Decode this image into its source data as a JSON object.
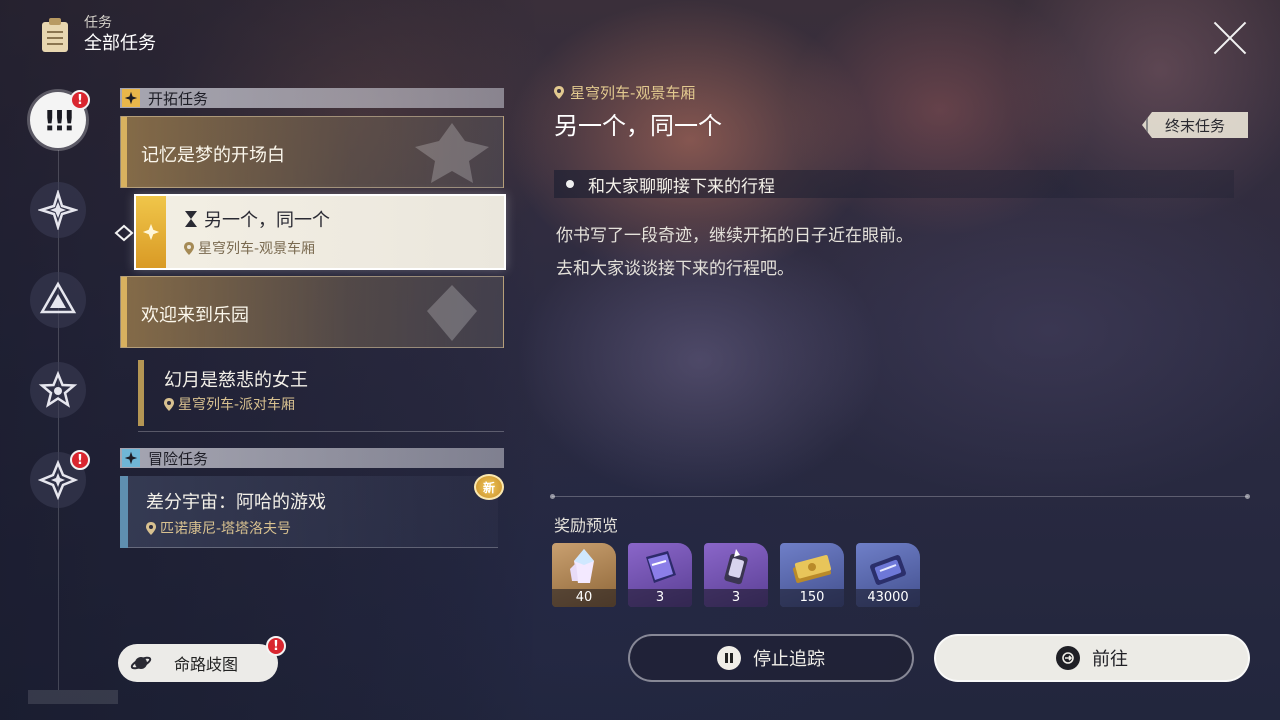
{
  "header": {
    "sub_title": "任务",
    "title": "全部任务"
  },
  "sections": {
    "trailblaze": "开拓任务",
    "adventure": "冒险任务"
  },
  "missions": [
    {
      "title": "记忆是梦的开场白"
    },
    {
      "title": "另一个，同一个",
      "location": "星穹列车-观景车厢"
    },
    {
      "title": "欢迎来到乐园"
    },
    {
      "title": "幻月是慈悲的女王",
      "location": "星穹列车-派对车厢"
    }
  ],
  "adventure_missions": [
    {
      "title": "差分宇宙：阿哈的游戏",
      "location": "匹诺康尼-塔塔洛夫号",
      "badge": "新"
    }
  ],
  "rail": {
    "badges": [
      "!",
      "!"
    ]
  },
  "path_button": {
    "label": "命路歧图",
    "badge": "!"
  },
  "detail": {
    "location": "星穹列车-观景车厢",
    "title": "另一个，同一个",
    "tag": "终末任务",
    "objective": "和大家聊聊接下来的行程",
    "description_lines": [
      "你书写了一段奇迹，继续开拓的日子近在眼前。",
      "去和大家谈谈接下来的行程吧。"
    ],
    "rewards_title": "奖励预览",
    "rewards": [
      {
        "icon": "crystal-icon",
        "qty": "40"
      },
      {
        "icon": "book-icon",
        "qty": "3"
      },
      {
        "icon": "canister-icon",
        "qty": "3"
      },
      {
        "icon": "credits-icon",
        "qty": "150"
      },
      {
        "icon": "exp-card-icon",
        "qty": "43000"
      }
    ]
  },
  "buttons": {
    "stop": "停止追踪",
    "go": "前往"
  },
  "colors": {
    "gold": "#d8b15f",
    "accent_blue": "#5f8fb0",
    "badge_red": "#d9262f"
  }
}
